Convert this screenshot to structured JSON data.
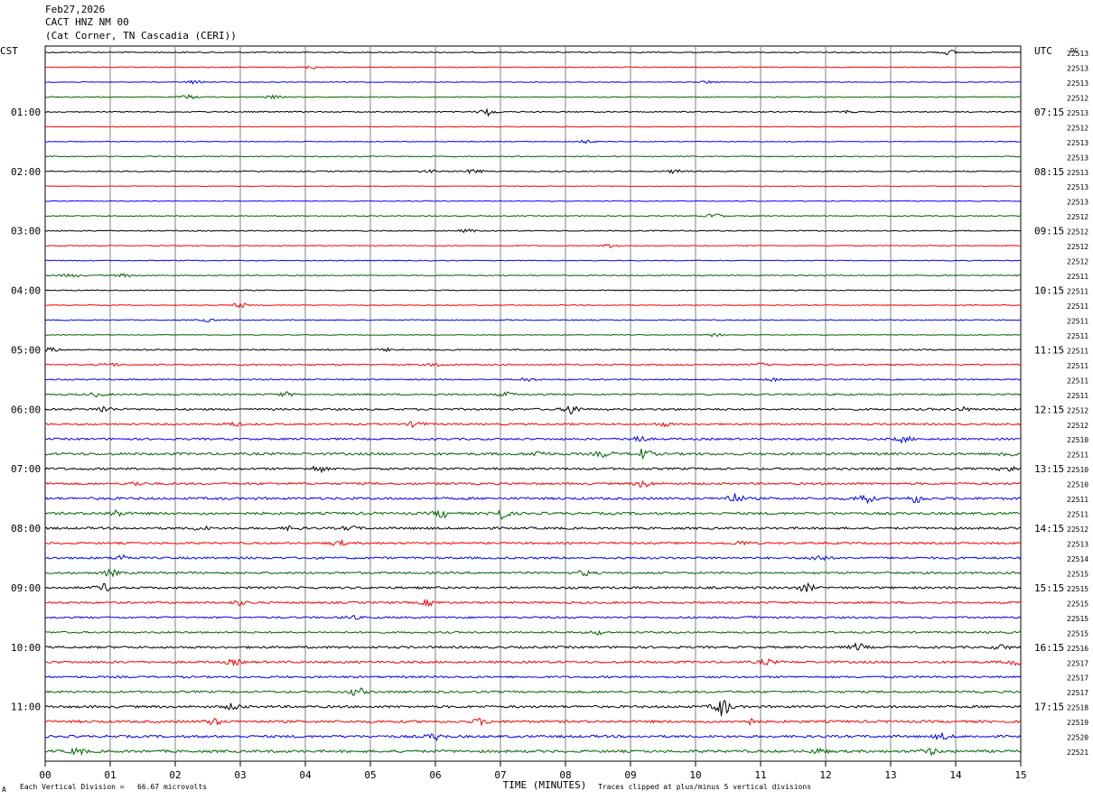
{
  "header": {
    "date": "Feb27,2026",
    "station": "CACT HNZ NM 00",
    "location": "(Cat Corner, TN Cascadia (CERI))"
  },
  "footer": {
    "mark": "A",
    "scale_note": "Each Vertical Division =   66.67 microvolts",
    "clip_note": "Traces clipped at plus/minus 5 vertical divisions"
  },
  "colors": [
    "#000000",
    "#ff0000",
    "#0000ff",
    "#006400"
  ],
  "chart_data": {
    "type": "line",
    "title": "",
    "left_label": "CST",
    "right_label": "UTC",
    "dc_label": "DC",
    "xlabel": "TIME (MINUTES)",
    "x_ticks": [
      "00",
      "01",
      "02",
      "03",
      "04",
      "05",
      "06",
      "07",
      "08",
      "09",
      "10",
      "11",
      "12",
      "13",
      "14",
      "15"
    ],
    "xlim": [
      0,
      15
    ],
    "left_hours": [
      "01:00",
      "02:00",
      "03:00",
      "04:00",
      "05:00",
      "06:00",
      "07:00",
      "08:00",
      "09:00",
      "10:00",
      "11:00"
    ],
    "right_hours": [
      "07:15",
      "08:15",
      "09:15",
      "10:15",
      "11:15",
      "12:15",
      "13:15",
      "14:15",
      "15:15",
      "16:15",
      "17:15"
    ],
    "dc_values": [
      "22513",
      "22513",
      "22513",
      "22512",
      "22513",
      "22512",
      "22513",
      "22513",
      "22513",
      "22513",
      "22513",
      "22512",
      "22512",
      "22512",
      "22512",
      "22511",
      "22511",
      "22511",
      "22511",
      "22511",
      "22511",
      "22511",
      "22511",
      "22511",
      "22512",
      "22512",
      "22510",
      "22511",
      "22510",
      "22510",
      "22511",
      "22511",
      "22512",
      "22513",
      "22514",
      "22515",
      "22515",
      "22515",
      "22515",
      "22515",
      "22516",
      "22517",
      "22517",
      "22517",
      "22518",
      "22519",
      "22520",
      "22521"
    ],
    "traces": [
      {
        "noise": 1.0,
        "events": [
          [
            13.9,
            2.5
          ]
        ]
      },
      {
        "noise": 0.8,
        "events": [
          [
            4.1,
            1.5
          ]
        ]
      },
      {
        "noise": 0.7,
        "events": [
          [
            2.3,
            2
          ],
          [
            10.2,
            1.5
          ]
        ]
      },
      {
        "noise": 0.9,
        "events": [
          [
            2.2,
            2
          ],
          [
            3.5,
            1.5
          ]
        ]
      },
      {
        "noise": 1.0,
        "events": [
          [
            6.8,
            4
          ],
          [
            12.3,
            1.5
          ]
        ]
      },
      {
        "noise": 0.7,
        "events": []
      },
      {
        "noise": 0.7,
        "events": [
          [
            8.3,
            2
          ]
        ]
      },
      {
        "noise": 0.9,
        "events": []
      },
      {
        "noise": 1.0,
        "events": [
          [
            5.9,
            1.5
          ],
          [
            6.6,
            2.5
          ],
          [
            9.7,
            2
          ]
        ]
      },
      {
        "noise": 0.6,
        "events": []
      },
      {
        "noise": 0.7,
        "events": []
      },
      {
        "noise": 0.9,
        "events": [
          [
            10.3,
            2.5
          ]
        ]
      },
      {
        "noise": 1.0,
        "events": [
          [
            6.5,
            1.5
          ]
        ]
      },
      {
        "noise": 0.8,
        "events": [
          [
            8.7,
            2
          ]
        ]
      },
      {
        "noise": 0.8,
        "events": []
      },
      {
        "noise": 1.0,
        "events": [
          [
            0.4,
            2
          ],
          [
            1.2,
            1.5
          ]
        ]
      },
      {
        "noise": 0.9,
        "events": []
      },
      {
        "noise": 0.8,
        "events": [
          [
            3.0,
            2.5
          ]
        ]
      },
      {
        "noise": 0.9,
        "events": [
          [
            2.5,
            1.5
          ]
        ]
      },
      {
        "noise": 0.7,
        "events": [
          [
            10.3,
            1.5
          ]
        ]
      },
      {
        "noise": 1.2,
        "events": [
          [
            0.1,
            2
          ],
          [
            5.3,
            1.5
          ]
        ]
      },
      {
        "noise": 1.3,
        "events": [
          [
            1.0,
            2
          ],
          [
            6.0,
            1.5
          ],
          [
            11.0,
            1.5
          ]
        ]
      },
      {
        "noise": 1.2,
        "events": [
          [
            7.4,
            2
          ],
          [
            11.2,
            1.5
          ]
        ]
      },
      {
        "noise": 1.5,
        "events": [
          [
            0.8,
            2
          ],
          [
            3.7,
            2
          ],
          [
            7.1,
            2
          ]
        ]
      },
      {
        "noise": 1.8,
        "events": [
          [
            0.9,
            3
          ],
          [
            8.1,
            5
          ],
          [
            14.1,
            2
          ]
        ]
      },
      {
        "noise": 1.6,
        "events": [
          [
            2.9,
            2
          ],
          [
            5.7,
            3
          ],
          [
            9.5,
            2
          ]
        ]
      },
      {
        "noise": 1.8,
        "events": [
          [
            9.1,
            4
          ],
          [
            13.2,
            3
          ]
        ]
      },
      {
        "noise": 2.2,
        "events": [
          [
            7.6,
            3
          ],
          [
            8.6,
            3
          ],
          [
            9.2,
            5
          ],
          [
            14.8,
            3
          ]
        ]
      },
      {
        "noise": 2.0,
        "events": [
          [
            4.2,
            3
          ],
          [
            14.8,
            3
          ]
        ]
      },
      {
        "noise": 1.9,
        "events": [
          [
            1.4,
            2
          ],
          [
            9.2,
            3.5
          ]
        ]
      },
      {
        "noise": 2.2,
        "events": [
          [
            10.6,
            5
          ],
          [
            12.6,
            5
          ],
          [
            13.4,
            4
          ]
        ]
      },
      {
        "noise": 2.2,
        "events": [
          [
            1.1,
            3
          ],
          [
            6.1,
            4
          ],
          [
            7.0,
            6
          ]
        ]
      },
      {
        "noise": 2.0,
        "events": [
          [
            2.4,
            2
          ],
          [
            3.8,
            2
          ],
          [
            4.7,
            2
          ]
        ]
      },
      {
        "noise": 1.8,
        "events": [
          [
            4.5,
            2.5
          ],
          [
            10.7,
            2
          ]
        ]
      },
      {
        "noise": 1.9,
        "events": [
          [
            1.2,
            3
          ],
          [
            11.9,
            3
          ]
        ]
      },
      {
        "noise": 1.9,
        "events": [
          [
            1.0,
            3
          ],
          [
            8.3,
            2.5
          ]
        ]
      },
      {
        "noise": 2.0,
        "events": [
          [
            0.9,
            3.5
          ],
          [
            11.7,
            4
          ]
        ]
      },
      {
        "noise": 1.8,
        "events": [
          [
            3.0,
            2.5
          ],
          [
            5.9,
            2.5
          ]
        ]
      },
      {
        "noise": 1.7,
        "events": [
          [
            4.7,
            2
          ],
          [
            10.8,
            2
          ]
        ]
      },
      {
        "noise": 1.6,
        "events": [
          [
            8.5,
            2
          ]
        ]
      },
      {
        "noise": 2.0,
        "events": [
          [
            12.5,
            3.5
          ],
          [
            14.7,
            2.5
          ]
        ]
      },
      {
        "noise": 2.0,
        "events": [
          [
            2.9,
            2.5
          ],
          [
            11.1,
            2.5
          ],
          [
            14.9,
            3
          ]
        ]
      },
      {
        "noise": 1.8,
        "events": []
      },
      {
        "noise": 1.9,
        "events": [
          [
            4.8,
            4
          ]
        ]
      },
      {
        "noise": 2.2,
        "events": [
          [
            2.9,
            3
          ],
          [
            10.4,
            10
          ]
        ]
      },
      {
        "noise": 2.2,
        "events": [
          [
            2.6,
            3
          ],
          [
            6.7,
            3
          ],
          [
            10.8,
            3
          ]
        ]
      },
      {
        "noise": 2.2,
        "events": [
          [
            6.0,
            3
          ],
          [
            13.8,
            3
          ]
        ]
      },
      {
        "noise": 2.3,
        "events": [
          [
            0.5,
            3
          ],
          [
            11.9,
            2.5
          ],
          [
            13.6,
            3
          ]
        ]
      }
    ]
  }
}
